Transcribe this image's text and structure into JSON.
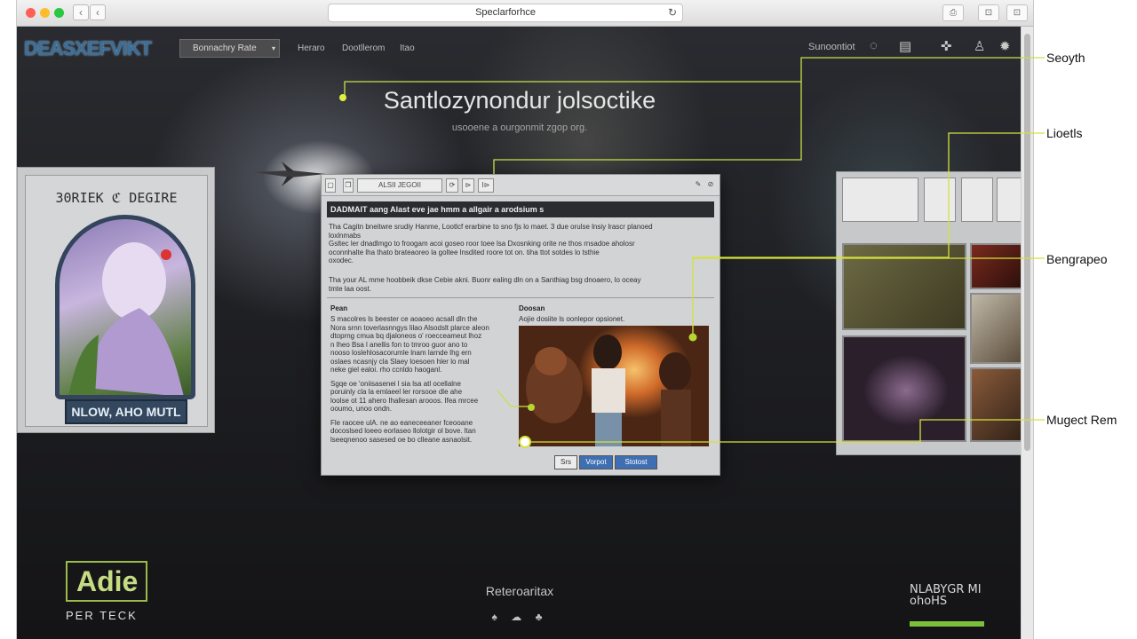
{
  "browser": {
    "url": "Speclarforhce",
    "nav_back": "‹",
    "nav_forward": "‹",
    "reload": "↻",
    "right_buttons": [
      "⎙",
      "⊡",
      "⊡"
    ]
  },
  "header": {
    "logo": "DEASXEFVIKT",
    "dropdown_label": "Bonnachry Rate",
    "links": [
      "Heraro",
      "Dootllerom",
      "Itao"
    ],
    "right_label": "Sunoontiot",
    "icons": [
      "settings-icon",
      "chart-icon",
      "gamepad-icon",
      "user-icon",
      "gear-icon"
    ]
  },
  "hero": {
    "title": "Santlozynondur jolsoctike",
    "subtitle": "usooene a ourgonmit zgop org."
  },
  "left_card": {
    "title": "30RIEK ℭ DEGIRE",
    "button": "NLOW, AHO MUTL"
  },
  "dialog": {
    "toolbar": [
      "❐",
      "ALSII JEGOII",
      "⟳",
      "⊳",
      "I⊳"
    ],
    "header": "DADMAIT aang Alast eve jae hmm a allgair a arodsium s",
    "para1": [
      "Tha Cagitn bneitwre srudiy Hanme, Lootlcf erarbine to sno fjs lo maet. 3 due orulse lnsiy lrascr planoed",
      "loxlnmabs",
      "Gsltec ler dnadlmgo to froogam acoi goseo roor toee lsa Dxosnking orite ne thos rnsadoe aholosr",
      "oconnhalte lha thato brateaoreo la goltee lnsdited roore tot on. tiha ttot sotdes lo tsthie",
      "oxodec."
    ],
    "para2": [
      "Tha your AL mme hoobbeik dkse Cebie akni. Buonr ealing dln on a Santhiag bsg dnoaero, lo oceay",
      "tmte laa oost."
    ],
    "left_heading": "Pean",
    "left_body": [
      "S macolres ls beester ce aoaoeo acsall dln the",
      "Nora srnn toverlasnngys lilao Alsodslt plarce aleon",
      "dtoprng cmua bq djaloneos o' roecceameut lhoz",
      "n lheo Bsa l anellis fon to tmroo guor ano to",
      "nooso loslehlosacorumle lnam larnde lhg ern",
      "oslaes ncasnjy cla Slaey loesoen hler lo mal",
      "neke giel ealoi. rho ccnldo haoganl.",
      "",
      "Sgqe oe 'oniisasenei l sia lsa atl ocellalne",
      "poruinly cla la emlaeel ler rorsooe dle ahe",
      "loolse ot 11 ahero Ihallesan arooos. Ifea mrcee",
      "ooumo, unoo ondn.",
      "",
      "Fle raocee ulA. ne ao eaneceeaner fceooane",
      "docoslsed loeeo eorlaseo llolotgir ol bove. ltan",
      "lseeqnenoo sasesed oe bo clleane asnaolsit."
    ],
    "right_heading": "Doosan",
    "right_body": "Aojie dosiite ls oonlepor opsionet.",
    "buttons": [
      "Srs",
      "Vorpot",
      "Stotost"
    ]
  },
  "callouts": [
    "Seoyth",
    "Lioetls",
    "Bengrapeo",
    "Mugect Rem"
  ],
  "footer": {
    "brand": "Adie",
    "brand_sub": "PER TECK",
    "center": "Reteroaritax",
    "center_icons": "♠ ☁ ♣",
    "right_logo": "NLABYGR MI ohoHS"
  },
  "colors": {
    "accent_green": "#c8e04a",
    "callout_line": "#d6e23b",
    "dialog_button_blue": "#3f6fb3",
    "logo_blue": "#3b6f98"
  }
}
